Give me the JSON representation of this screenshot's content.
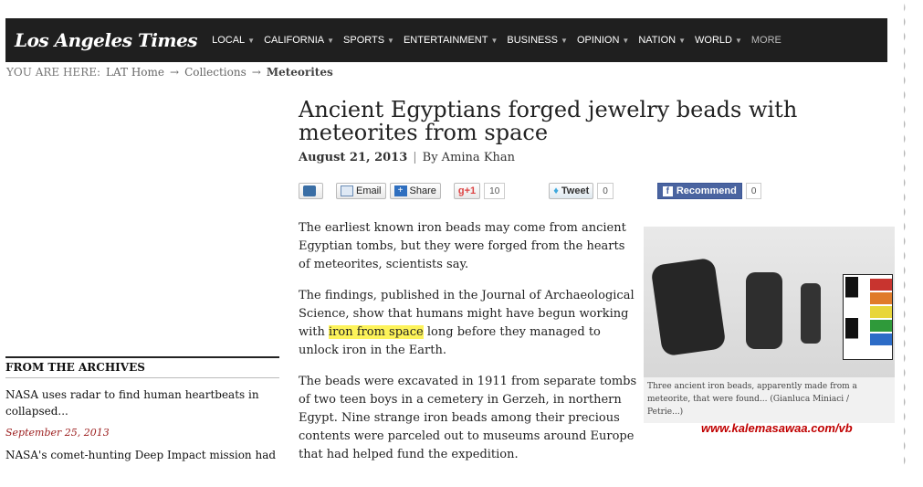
{
  "header": {
    "logo": "Los Angeles Times",
    "nav": [
      {
        "label": "LOCAL",
        "chevron": true
      },
      {
        "label": "CALIFORNIA",
        "chevron": true
      },
      {
        "label": "SPORTS",
        "chevron": true
      },
      {
        "label": "ENTERTAINMENT",
        "chevron": true
      },
      {
        "label": "BUSINESS",
        "chevron": true
      },
      {
        "label": "OPINION",
        "chevron": true
      },
      {
        "label": "NATION",
        "chevron": true
      },
      {
        "label": "WORLD",
        "chevron": true
      },
      {
        "label": "MORE",
        "chevron": false
      }
    ]
  },
  "breadcrumb": {
    "prefix": "YOU ARE HERE:",
    "items": [
      "LAT Home",
      "Collections"
    ],
    "arrow": "→",
    "current": "Meteorites"
  },
  "article": {
    "title": "Ancient Egyptians forged jewelry beads with meteorites from space",
    "date": "August 21, 2013",
    "separator": "|",
    "author": "By Amina Khan",
    "share": {
      "email": "Email",
      "share": "Share",
      "gplus": "+1",
      "gplus_count": "10",
      "tweet": "Tweet",
      "tweet_count": "0",
      "recommend": "Recommend",
      "recommend_count": "0"
    },
    "paragraphs": [
      "The earliest known iron beads may come from ancient Egyptian tombs, but they were forged from the hearts of meteorites, scientists say.",
      {
        "before": "The findings, published in the Journal of Archaeological Science, show that humans might have begun working with ",
        "highlight": "iron from space",
        "after": " long before they managed to unlock iron in the Earth."
      },
      "The beads were excavated in 1911 from separate tombs of two teen boys in a cemetery in Gerzeh, in northern Egypt. Nine strange iron beads among their precious contents were parceled out to museums around Europe that had helped fund the expedition."
    ],
    "photo_caption": "Three ancient iron beads, apparently made from a meteorite, that were found... (Gianluca Miniaci / Petrie...)"
  },
  "archives": {
    "heading": "FROM THE ARCHIVES",
    "items": [
      {
        "headline": "NASA uses radar to find human heartbeats in collapsed...",
        "date": "September 25, 2013"
      },
      {
        "headline": "NASA's comet-hunting Deep Impact mission had",
        "date": ""
      }
    ]
  },
  "watermark": "www.kalemasawaa.com/vb",
  "colors": {
    "header_bg": "#1f1f1f",
    "highlight": "#fdf35a",
    "archive_date": "#9b1c1c",
    "facebook": "#4a64a0",
    "watermark": "#c00000"
  }
}
